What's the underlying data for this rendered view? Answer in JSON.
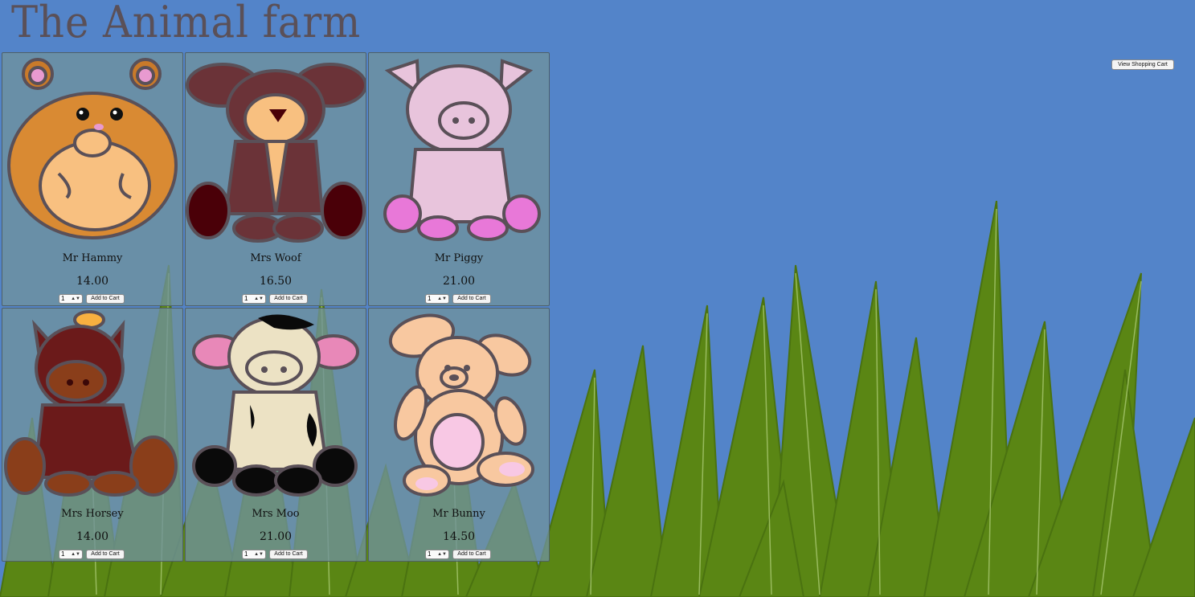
{
  "site": {
    "title": "The Animal farm"
  },
  "header": {
    "cart_button_label": "View Shopping Cart"
  },
  "products": [
    {
      "name": "Mr Hammy",
      "price": "14.00",
      "qty": "1",
      "add_label": "Add to Cart",
      "icon": "hamster-icon"
    },
    {
      "name": "Mrs Woof",
      "price": "16.50",
      "qty": "1",
      "add_label": "Add to Cart",
      "icon": "dog-icon"
    },
    {
      "name": "Mr Piggy",
      "price": "21.00",
      "qty": "1",
      "add_label": "Add to Cart",
      "icon": "pig-icon"
    },
    {
      "name": "Mrs Horsey",
      "price": "14.00",
      "qty": "1",
      "add_label": "Add to Cart",
      "icon": "horse-icon"
    },
    {
      "name": "Mrs Moo",
      "price": "21.00",
      "qty": "1",
      "add_label": "Add to Cart",
      "icon": "cow-icon"
    },
    {
      "name": "Mr Bunny",
      "price": "14.50",
      "qty": "1",
      "add_label": "Add to Cart",
      "icon": "bunny-icon"
    }
  ],
  "colors": {
    "sky": "#5384c9",
    "grass": "#5a8614",
    "grass_highlight": "#a8c870",
    "card": "#70929e",
    "title": "#5a5058"
  }
}
